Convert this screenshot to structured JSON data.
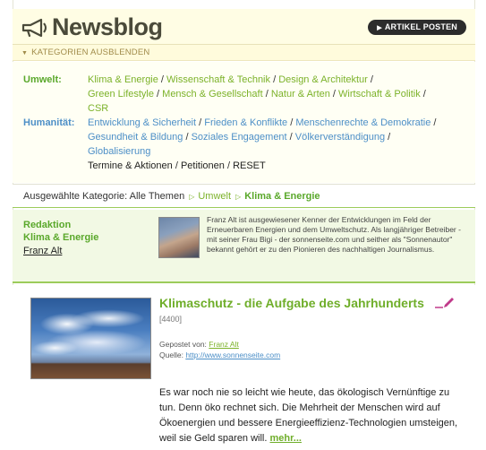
{
  "header": {
    "title": "Newsblog",
    "post_button": "ARTIKEL POSTEN",
    "logo_icon": "megaphone-icon"
  },
  "collapse_label": "KATEGORIEN AUSBLENDEN",
  "categories": {
    "umwelt": {
      "label": "Umwelt:",
      "line1": [
        "Klima & Energie",
        "Wissenschaft & Technik",
        "Design & Architektur"
      ],
      "line2": [
        "Green Lifestyle",
        "Mensch & Gesellschaft",
        "Natur & Arten",
        "Wirtschaft & Politik"
      ],
      "line3": [
        "CSR"
      ]
    },
    "humanitaet": {
      "label": "Humanität:",
      "line1": [
        "Entwicklung & Sicherheit",
        "Frieden & Konflikte",
        "Menschenrechte & Demokratie"
      ],
      "line2": [
        "Gesundheit & Bildung",
        "Soziales Engagement",
        "Völkerverständigung"
      ],
      "line3": [
        "Globalisierung"
      ]
    },
    "other": [
      "Termine & Aktionen",
      "Petitionen",
      "RESET"
    ]
  },
  "breadcrumb": {
    "prefix": "Ausgewählte Kategorie: Alle Themen",
    "level1": "Umwelt",
    "level2": "Klima & Energie"
  },
  "editor": {
    "title_line1": "Redaktion",
    "title_line2": "Klima & Energie",
    "name": "Franz Alt",
    "bio": "Franz Alt ist ausgewiesener Kenner der Entwicklungen im Feld der Erneuerbaren Energien und dem Umweltschutz. Als langjähriger Betreiber - mit seiner Frau Bigi - der sonnenseite.com und seither als \"Sonnenautor\" bekannt gehört er zu den Pionieren des nachhaltigen Journalismus."
  },
  "article": {
    "title": "Klimaschutz - die Aufgabe des Jahrhunderts",
    "id": "[4400]",
    "posted_by_label": "Gepostet von:",
    "posted_by": "Franz Alt",
    "source_label": "Quelle:",
    "source": "http://www.sonnenseite.com",
    "body": "Es war noch nie so leicht wie heute, das ökologisch Vernünftige zu tun. Denn öko rechnet sich. Die Mehrheit der Menschen wird auf Ökoenergien und bessere Energieeffizienz-Technologien umsteigen, weil sie Geld sparen will.",
    "more": "mehr..."
  },
  "colors": {
    "accent_green": "#7cb22a",
    "link_blue": "#4d8fc7",
    "header_bg": "#fffde4"
  }
}
